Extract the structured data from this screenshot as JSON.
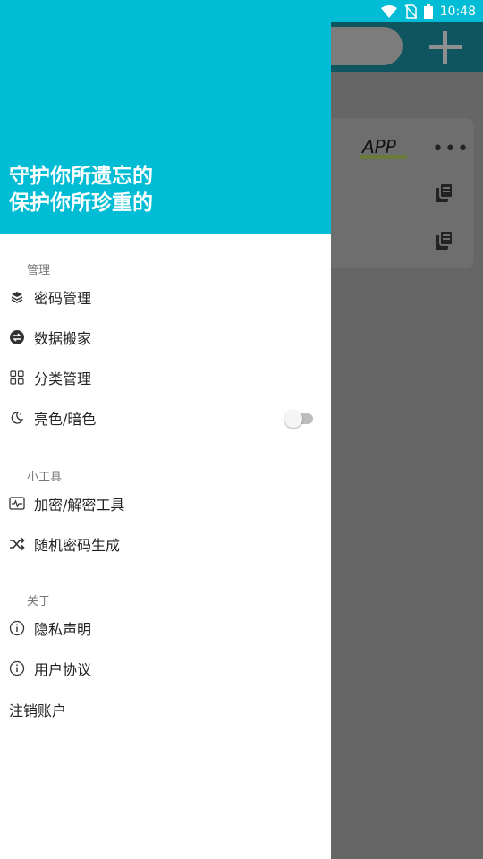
{
  "status_bar": {
    "time": "10:48",
    "icons": [
      "wifi-icon",
      "no-sim-icon",
      "battery-icon"
    ]
  },
  "background": {
    "card_app_label": "APP",
    "more_icon": "more-horiz-icon",
    "copy_icon": "copy-icon",
    "add_icon": "plus-icon"
  },
  "drawer": {
    "slogan_line1": "守护你所遗忘的",
    "slogan_line2": "保护你所珍重的",
    "sections": {
      "manage": {
        "title": "管理",
        "items": [
          {
            "label": "密码管理",
            "icon": "layers-icon"
          },
          {
            "label": "数据搬家",
            "icon": "transfer-icon"
          },
          {
            "label": "分类管理",
            "icon": "grid-icon"
          },
          {
            "label": "亮色/暗色",
            "icon": "moon-icon",
            "toggle_on": false
          }
        ]
      },
      "tools": {
        "title": "小工具",
        "items": [
          {
            "label": "加密/解密工具",
            "icon": "monitor-pulse-icon"
          },
          {
            "label": "随机密码生成",
            "icon": "shuffle-icon"
          }
        ]
      },
      "about": {
        "title": "关于",
        "items": [
          {
            "label": "隐私声明",
            "icon": "info-icon"
          },
          {
            "label": "用户协议",
            "icon": "info-icon"
          }
        ]
      }
    },
    "logout_label": "注销账户"
  },
  "colors": {
    "header": "#00bcd4",
    "toolbar_dimmed": "#0e5560",
    "scrim": "#666666"
  }
}
